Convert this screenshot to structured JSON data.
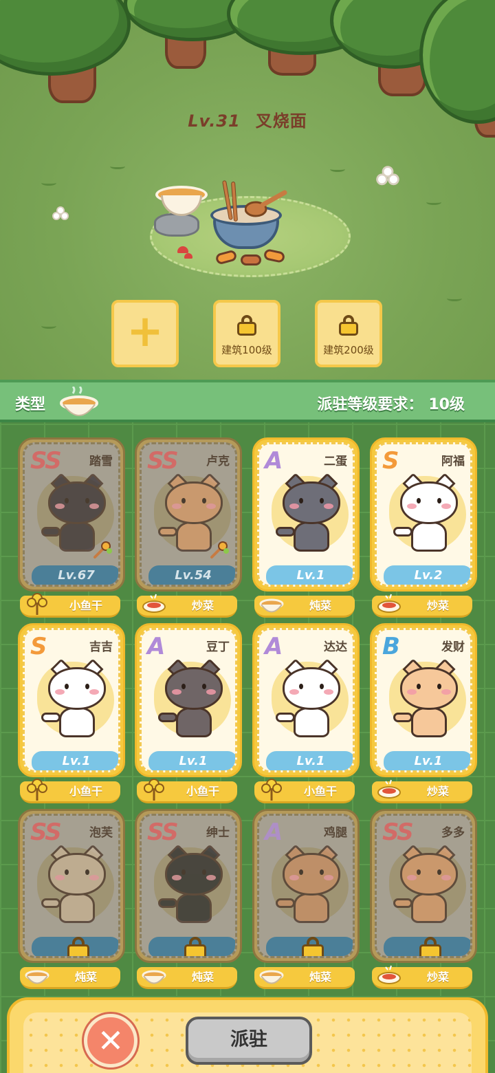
{
  "building": {
    "level": "Lv.31",
    "name": "叉烧面"
  },
  "slots": [
    {
      "type": "add",
      "icon": "plus-icon"
    },
    {
      "type": "locked",
      "icon": "lock-icon",
      "requirement": "建筑100级"
    },
    {
      "type": "locked",
      "icon": "lock-icon",
      "requirement": "建筑200级"
    }
  ],
  "panel": {
    "type_label": "类型",
    "type_icon": "ramen-bowl-icon",
    "requirement_label": "派驻等级要求：",
    "requirement_value": "10级"
  },
  "cats": [
    {
      "rarity": "SS",
      "name": "踏雪",
      "level": "Lv.67",
      "state": "assigned",
      "skill": "小鱼干",
      "skill_icon": "fish-flower-icon",
      "fur": "#3a3338",
      "accent": "#6b5a55"
    },
    {
      "rarity": "SS",
      "name": "卢克",
      "level": "Lv.54",
      "state": "assigned",
      "skill": "炒菜",
      "skill_icon": "stir-fry-plate-icon",
      "fur": "#d79b6c",
      "accent": "#fff4e6"
    },
    {
      "rarity": "A",
      "name": "二蛋",
      "level": "Lv.1",
      "state": "available",
      "skill": "炖菜",
      "skill_icon": "stew-bowl-icon",
      "fur": "#6e6e78",
      "accent": "#8c8c96"
    },
    {
      "rarity": "S",
      "name": "阿福",
      "level": "Lv.2",
      "state": "available",
      "skill": "炒菜",
      "skill_icon": "stir-fry-plate-icon",
      "fur": "#ffffff",
      "accent": "#5a3a2a"
    },
    {
      "rarity": "S",
      "name": "吉吉",
      "level": "Lv.1",
      "state": "available",
      "skill": "小鱼干",
      "skill_icon": "fish-flower-icon",
      "fur": "#ffffff",
      "accent": "#2c2c2c"
    },
    {
      "rarity": "A",
      "name": "豆丁",
      "level": "Lv.1",
      "state": "available",
      "skill": "小鱼干",
      "skill_icon": "fish-flower-icon",
      "fur": "#6f6566",
      "accent": "#8b7f80"
    },
    {
      "rarity": "A",
      "name": "达达",
      "level": "Lv.1",
      "state": "available",
      "skill": "小鱼干",
      "skill_icon": "fish-flower-icon",
      "fur": "#ffffff",
      "accent": "#3c8fe0"
    },
    {
      "rarity": "B",
      "name": "发财",
      "level": "Lv.1",
      "state": "available",
      "skill": "炒菜",
      "skill_icon": "stir-fry-plate-icon",
      "fur": "#f6c89a",
      "accent": "#fff0de"
    },
    {
      "rarity": "SS",
      "name": "泡芙",
      "level": "",
      "state": "locked",
      "skill": "炖菜",
      "skill_icon": "stew-bowl-icon",
      "fur": "#c9b59a",
      "accent": "#7a6a5a"
    },
    {
      "rarity": "SS",
      "name": "绅士",
      "level": "",
      "state": "locked",
      "skill": "炖菜",
      "skill_icon": "stew-bowl-icon",
      "fur": "#2c2c2c",
      "accent": "#ffffff"
    },
    {
      "rarity": "A",
      "name": "鸡腿",
      "level": "",
      "state": "locked",
      "skill": "炖菜",
      "skill_icon": "stew-bowl-icon",
      "fur": "#c98e64",
      "accent": "#e9c6a6"
    },
    {
      "rarity": "SS",
      "name": "多多",
      "level": "",
      "state": "locked",
      "skill": "炒菜",
      "skill_icon": "stir-fry-plate-icon",
      "fur": "#d99a6a",
      "accent": "#f3d8bd"
    }
  ],
  "rarity_colors": {
    "SS": "#e05a5a",
    "S": "#f39a3a",
    "A": "#b08ad8",
    "B": "#4aa6dc"
  },
  "footer": {
    "close_icon": "close-icon",
    "assign_label": "派驻"
  }
}
